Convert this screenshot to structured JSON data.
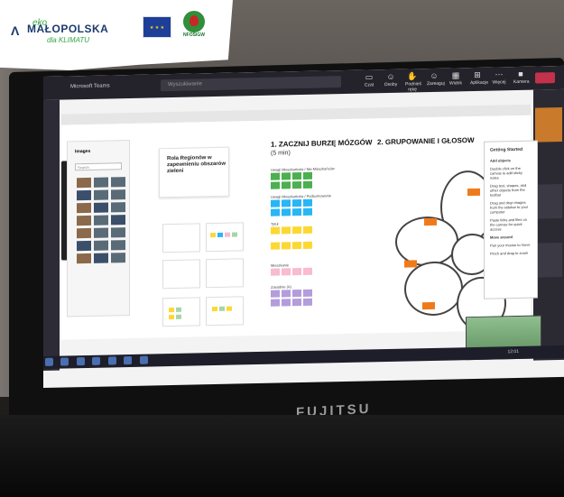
{
  "banner": {
    "eko": "eko",
    "brand": "MAŁOPOLSKA",
    "tagline": "dla KLIMATU",
    "fund_caption": "NFOŚiGW"
  },
  "laptop": {
    "brand": "FUJITSU"
  },
  "teams": {
    "window_title": "Microsoft Teams",
    "search_placeholder": "Wyszukiwanie",
    "controls": [
      {
        "icon": "chat-icon",
        "label": "Czat"
      },
      {
        "icon": "people-icon",
        "label": "Osoby"
      },
      {
        "icon": "hand-icon",
        "label": "Podnieś rękę"
      },
      {
        "icon": "react-icon",
        "label": "Zareaguj"
      },
      {
        "icon": "view-icon",
        "label": "Widok"
      },
      {
        "icon": "apps-icon",
        "label": "Aplikacje"
      },
      {
        "icon": "more-icon",
        "label": "Więcej"
      },
      {
        "icon": "camera-icon",
        "label": "Kamera"
      }
    ]
  },
  "board": {
    "panel_title": "Images",
    "panel_search": "Search",
    "card_title": "Rola Regionów w zapewnieniu obszarów zieleni",
    "step1_title": "1. ZACZNIJ BURZĘ MÓZGÓW",
    "step1_time": "(5 min)",
    "step2_title": "2. GRUPOWANIE I GŁOSOW",
    "labels": [
      "Uwagi Mieszkańców / Nie Mieszkańców",
      "Uwagi Mieszkańców / Podsumowanie",
      "Tytuł",
      "Mieszkanie",
      "Mieszkanie",
      "Zasadnie (A)"
    ],
    "getting_started": {
      "title": "Getting Started",
      "section1": "Add objects",
      "items": [
        "Double click on the canvas to add sticky notes",
        "Drag text, shapes, and other objects from the toolbar",
        "Drag and drop images from the sidebar to your computer",
        "Paste links and files on the canvas for quick access"
      ],
      "section2": "Move around",
      "moves": [
        "Pan your mouse to move",
        "Pinch and drag to zoom"
      ]
    }
  },
  "taskbar": {
    "clock": "12:01"
  },
  "colors": {
    "green_note": "#4caf50",
    "cyan_note": "#29b6f6",
    "yellow_note": "#fdd835",
    "pink_note": "#f8bbd0",
    "purple_note": "#b39ddb",
    "orange_note": "#f07a1a"
  }
}
